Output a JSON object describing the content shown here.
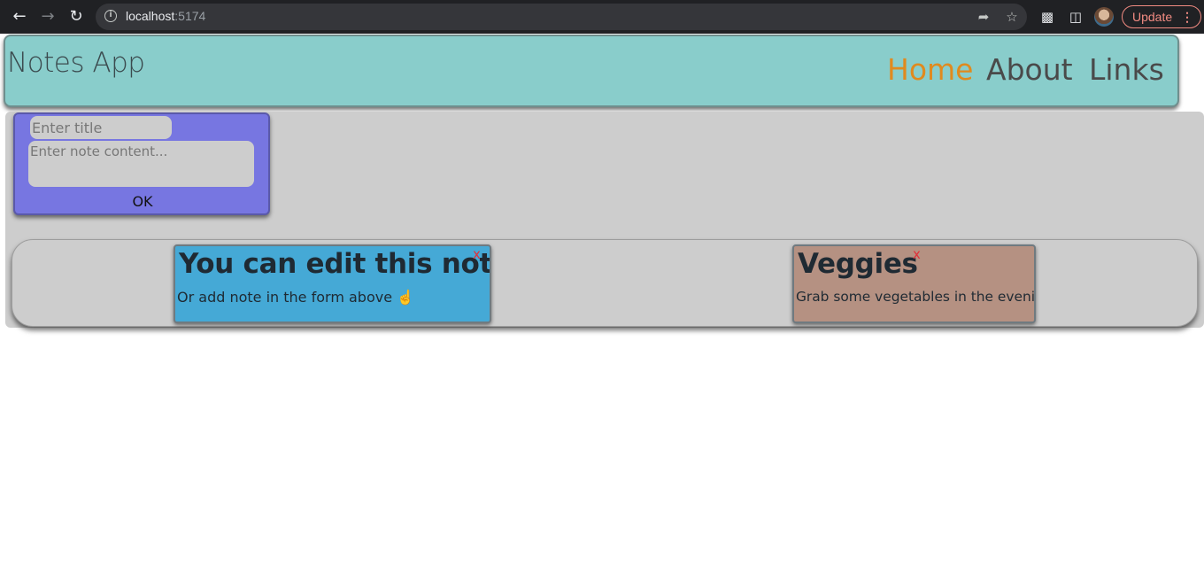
{
  "browser": {
    "url_host": "localhost",
    "url_port": ":5174",
    "update_label": "Update",
    "update_dots": "⋮",
    "icons": {
      "back": "back-arrow-icon",
      "forward": "forward-arrow-icon",
      "reload": "reload-icon",
      "site_info": "info-icon",
      "share": "share-icon",
      "bookmark": "star-icon",
      "extensions": "puzzle-icon",
      "side_panel": "side-panel-icon"
    }
  },
  "header": {
    "app_title": "Notes App",
    "nav": {
      "home": "Home",
      "about": "About",
      "links": "Links"
    },
    "active": "Home",
    "active_color": "#e08a1e"
  },
  "form": {
    "title_placeholder": "Enter title",
    "content_placeholder": "Enter note content...",
    "title_value": "",
    "content_value": "",
    "ok_label": "OK"
  },
  "notes": [
    {
      "title": "You can edit this note",
      "content": "Or add note in the form above ☝️",
      "close_label": "x",
      "color": "#45a9d6"
    },
    {
      "title": "Veggies",
      "content": "Grab some vegetables in the evening",
      "close_label": "x",
      "color": "#b59182"
    }
  ],
  "colors": {
    "header_bg": "#89cdcb",
    "form_bg": "#7776e1",
    "main_bg": "#cdcdcd"
  }
}
